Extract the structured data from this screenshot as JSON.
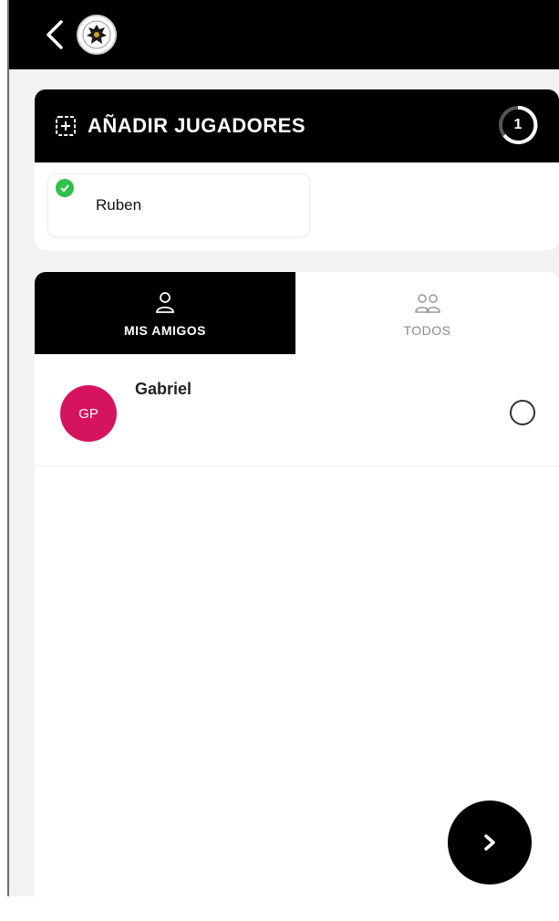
{
  "header": {
    "back_icon": "chevron-left-icon",
    "logo_icon": "crest-logo-icon"
  },
  "players_card": {
    "title": "AÑADIR JUGADORES",
    "icon": "add-square-icon",
    "count": "1",
    "selected": [
      {
        "name": "Ruben",
        "status_icon": "check-circle-icon",
        "status_color": "#2fc14a"
      }
    ]
  },
  "tabs": [
    {
      "label": "MIS AMIGOS",
      "icon": "person-icon",
      "active": true
    },
    {
      "label": "TODOS",
      "icon": "group-icon",
      "active": false
    }
  ],
  "friends": [
    {
      "initials": "GP",
      "name": "Gabriel",
      "avatar_color": "#d6135f",
      "selected": false
    }
  ],
  "fab": {
    "icon": "chevron-right-icon"
  }
}
